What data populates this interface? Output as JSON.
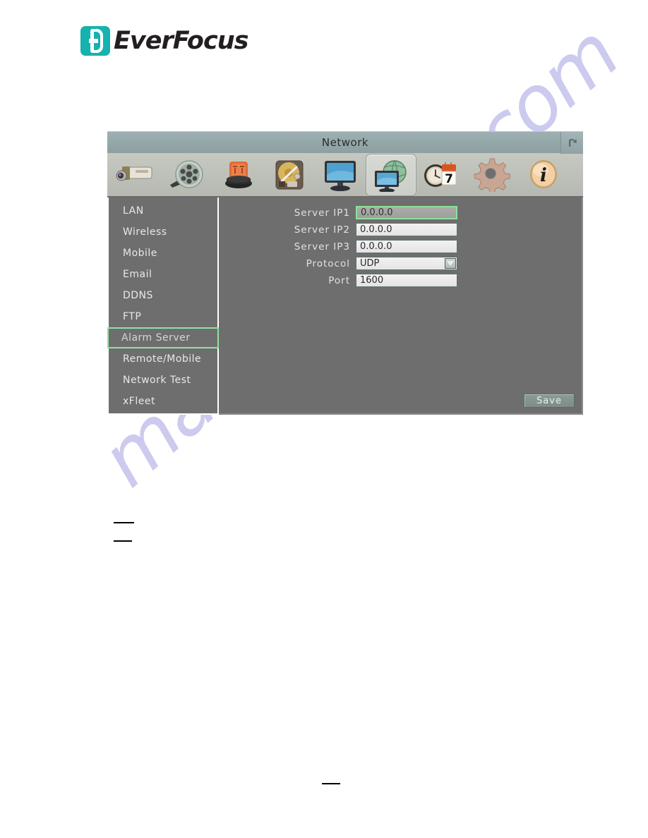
{
  "brand": {
    "name": "EverFocus",
    "logo_color": "#15b2ae"
  },
  "watermark": {
    "text": "manualshive.com",
    "color": "#b9b6e8"
  },
  "window": {
    "title": "Network",
    "back_icon": "back-arrow-icon"
  },
  "toolbar": {
    "selected_index": 5,
    "items": [
      {
        "icon": "camera-icon",
        "name": "camera"
      },
      {
        "icon": "film-reel-icon",
        "name": "record"
      },
      {
        "icon": "alarm-siren-icon",
        "name": "alarm"
      },
      {
        "icon": "hard-disk-icon",
        "name": "disk"
      },
      {
        "icon": "monitor-icon",
        "name": "display"
      },
      {
        "icon": "network-globe-icon",
        "name": "network"
      },
      {
        "icon": "clock-calendar-icon",
        "name": "date-time"
      },
      {
        "icon": "gear-icon",
        "name": "system"
      },
      {
        "icon": "info-icon",
        "name": "information"
      }
    ]
  },
  "sidebar": {
    "active": "Alarm Server",
    "items": [
      {
        "label": "LAN"
      },
      {
        "label": "Wireless"
      },
      {
        "label": "Mobile"
      },
      {
        "label": "Email"
      },
      {
        "label": "DDNS"
      },
      {
        "label": "FTP"
      },
      {
        "label": "Alarm Server"
      },
      {
        "label": "Remote/Mobile"
      },
      {
        "label": "Network Test"
      },
      {
        "label": "xFleet"
      }
    ]
  },
  "form": {
    "rows": [
      {
        "label": "Server  IP1",
        "value": "0.0.0.0",
        "type": "text",
        "focused": true
      },
      {
        "label": "Server  IP2",
        "value": "0.0.0.0",
        "type": "text",
        "focused": false
      },
      {
        "label": "Server  IP3",
        "value": "0.0.0.0",
        "type": "text",
        "focused": false
      },
      {
        "label": "Protocol",
        "value": "UDP",
        "type": "select",
        "focused": false
      },
      {
        "label": "Port",
        "value": "1600",
        "type": "text",
        "focused": false
      }
    ],
    "save_label": "Save",
    "focus_border_color": "#8ee09b"
  }
}
